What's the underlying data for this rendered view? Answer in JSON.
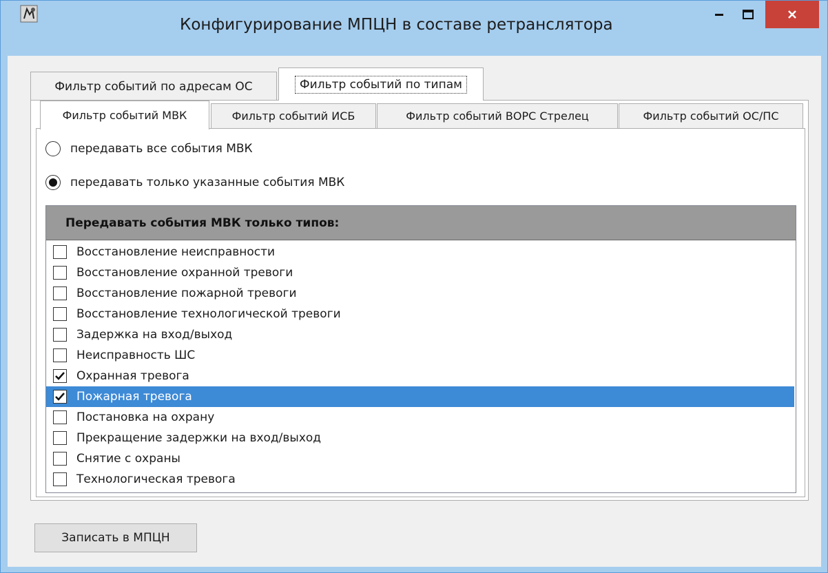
{
  "window": {
    "title": "Конфигурирование МПЦН в составе ретранслятора",
    "icon": "app-icon",
    "controls": [
      "minimize-icon",
      "maximize-icon",
      "close-icon"
    ]
  },
  "outer_tabs": [
    {
      "label": "Фильтр событий по адресам ОС",
      "active": false
    },
    {
      "label": "Фильтр событий по типам",
      "active": true
    }
  ],
  "inner_tabs": [
    {
      "label": "Фильтр событий МВК",
      "active": true
    },
    {
      "label": "Фильтр событий ИСБ",
      "active": false
    },
    {
      "label": "Фильтр событий ВОРС Стрелец",
      "active": false
    },
    {
      "label": "Фильтр событий ОС/ПС",
      "active": false
    }
  ],
  "radios": [
    {
      "label": "передавать все события МВК",
      "checked": false
    },
    {
      "label": "передавать только указанные события МВК",
      "checked": true
    }
  ],
  "list": {
    "header": "Передавать события МВК только типов:",
    "items": [
      {
        "label": "Восстановление неисправности",
        "checked": false,
        "selected": false
      },
      {
        "label": "Восстановление охранной тревоги",
        "checked": false,
        "selected": false
      },
      {
        "label": "Восстановление пожарной тревоги",
        "checked": false,
        "selected": false
      },
      {
        "label": "Восстановление технологической тревоги",
        "checked": false,
        "selected": false
      },
      {
        "label": "Задержка на вход/выход",
        "checked": false,
        "selected": false
      },
      {
        "label": "Неисправность ШС",
        "checked": false,
        "selected": false
      },
      {
        "label": "Охранная тревога",
        "checked": true,
        "selected": false
      },
      {
        "label": "Пожарная тревога",
        "checked": true,
        "selected": true
      },
      {
        "label": "Постановка на охрану",
        "checked": false,
        "selected": false
      },
      {
        "label": "Прекращение задержки на вход/выход",
        "checked": false,
        "selected": false
      },
      {
        "label": "Снятие с охраны",
        "checked": false,
        "selected": false
      },
      {
        "label": "Технологическая тревога",
        "checked": false,
        "selected": false
      }
    ]
  },
  "footer": {
    "write_button": "Записать в МПЦН"
  },
  "colors": {
    "titlebar": "#a5cdee",
    "close": "#c8423a",
    "selection": "#3d8ad6",
    "header": "#9a9a9a"
  }
}
